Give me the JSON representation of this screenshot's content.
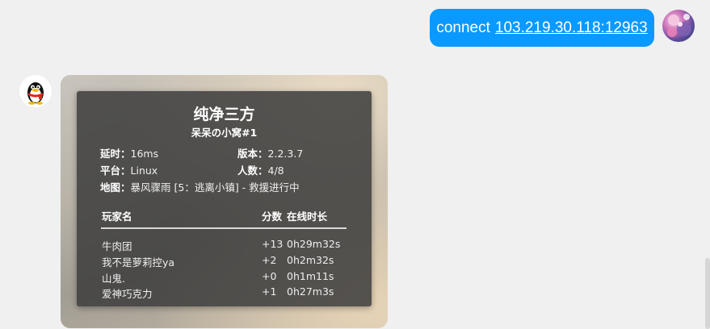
{
  "outgoing_message": {
    "command": "connect",
    "address": "103.219.30.118:12963"
  },
  "server_card": {
    "title": "纯净三方",
    "subtitle": "呆呆の小窝#1",
    "latency_label": "延时：",
    "latency_value": "16ms",
    "version_label": "版本：",
    "version_value": "2.2.3.7",
    "platform_label": "平台：",
    "platform_value": "Linux",
    "players_label": "人数：",
    "players_value": "4/8",
    "map_label": "地图：",
    "map_value": "暴风骤雨 [5：逃离小镇] - 救援进行中",
    "table_headers": {
      "player": "玩家名",
      "score": "分数",
      "online_time": "在线时长"
    },
    "players": [
      {
        "name": "牛肉团",
        "score": "+13",
        "time": "0h29m32s"
      },
      {
        "name": "我不是萝莉控ya",
        "score": "+2",
        "time": "0h2m32s"
      },
      {
        "name": "山鬼.",
        "score": "+0",
        "time": "0h1m11s"
      },
      {
        "name": "爱神巧克力",
        "score": "+1",
        "time": "0h27m3s"
      }
    ]
  },
  "icons": {
    "bot_avatar": "qq-penguin-icon",
    "user_avatar": "user-avatar-icon"
  }
}
